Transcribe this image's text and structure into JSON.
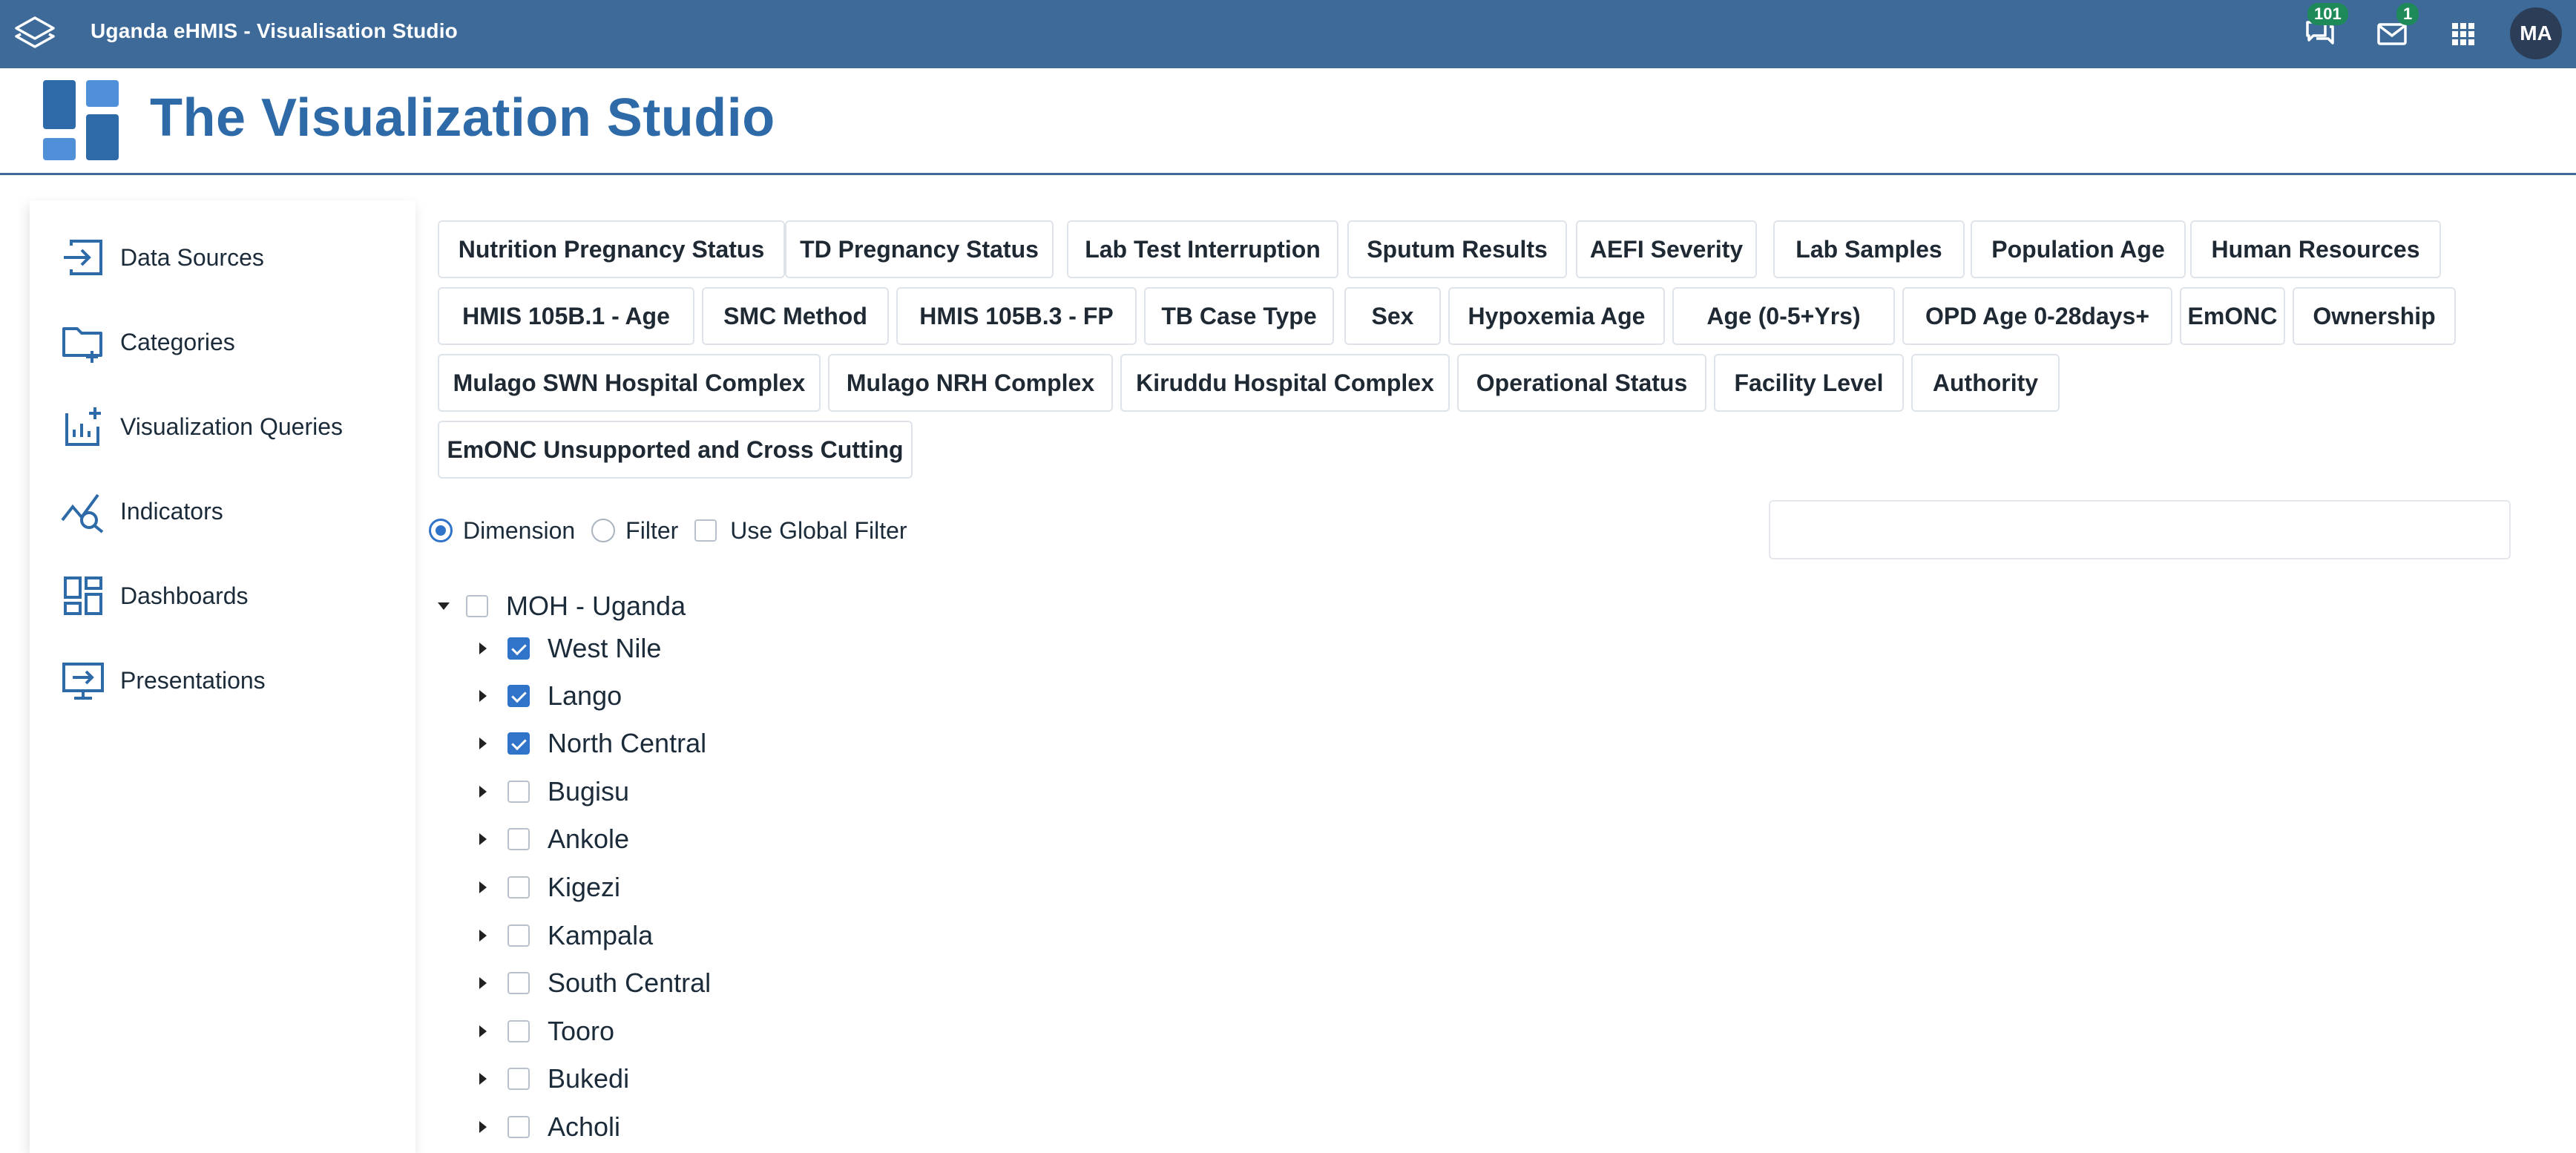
{
  "topbar": {
    "app_title": "Uganda eHMIS - Visualisation Studio",
    "messages_badge": "101",
    "mail_badge": "1",
    "avatar_initials": "MA",
    "bar_color": "#3d6a98"
  },
  "studio": {
    "title": "The Visualization Studio",
    "title_color": "#2d6aa7"
  },
  "sidebar": {
    "items": [
      {
        "label": "Data Sources",
        "icon": "login-arrow-icon"
      },
      {
        "label": "Categories",
        "icon": "folder-plus-icon"
      },
      {
        "label": "Visualization Queries",
        "icon": "chart-add-icon"
      },
      {
        "label": "Indicators",
        "icon": "trend-search-icon"
      },
      {
        "label": "Dashboards",
        "icon": "dashboard-grid-icon"
      },
      {
        "label": "Presentations",
        "icon": "presentation-screen-icon"
      }
    ]
  },
  "categories": [
    "Nutrition Pregnancy Status",
    "TD Pregnancy Status",
    "Lab Test Interruption",
    "Sputum Results",
    "AEFI Severity",
    "Lab Samples",
    "Population Age",
    "Human Resources",
    "HMIS 105B.1 - Age",
    "SMC Method",
    "HMIS 105B.3 - FP",
    "TB Case Type",
    "Sex",
    "Hypoxemia Age",
    "Age (0-5+Yrs)",
    "OPD Age 0-28days+",
    "EmONC",
    "Ownership",
    "Mulago SWN Hospital Complex",
    "Mulago NRH Complex",
    "Kiruddu Hospital Complex",
    "Operational Status",
    "Facility Level",
    "Authority",
    "EmONC Unsupported and Cross Cutting"
  ],
  "options": {
    "dimension_label": "Dimension",
    "dimension_selected": true,
    "filter_label": "Filter",
    "filter_selected": false,
    "global_filter_label": "Use Global Filter",
    "global_filter_checked": false,
    "search_value": ""
  },
  "tree": {
    "root": {
      "label": "MOH - Uganda",
      "checked": false,
      "expanded": true
    },
    "children": [
      {
        "label": "West Nile",
        "checked": true
      },
      {
        "label": "Lango",
        "checked": true
      },
      {
        "label": "North Central",
        "checked": true
      },
      {
        "label": "Bugisu",
        "checked": false
      },
      {
        "label": "Ankole",
        "checked": false
      },
      {
        "label": "Kigezi",
        "checked": false
      },
      {
        "label": "Kampala",
        "checked": false
      },
      {
        "label": "South Central",
        "checked": false
      },
      {
        "label": "Tooro",
        "checked": false
      },
      {
        "label": "Bukedi",
        "checked": false
      },
      {
        "label": "Acholi",
        "checked": false
      }
    ]
  }
}
